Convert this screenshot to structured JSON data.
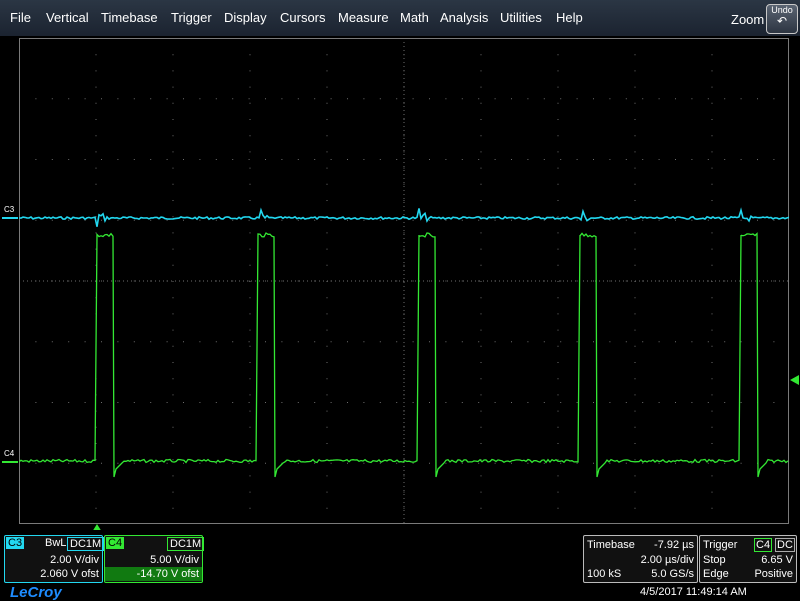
{
  "menu": [
    "File",
    "Vertical",
    "Timebase",
    "Trigger",
    "Display",
    "Cursors",
    "Measure",
    "Math",
    "Analysis",
    "Utilities",
    "Help"
  ],
  "zoom_label": "Zoom",
  "undo_label": "Undo",
  "traces": {
    "c3": {
      "label": "C3",
      "color": "#22d8f0"
    },
    "c4": {
      "label": "C4",
      "color": "#33e833"
    }
  },
  "c3_box": {
    "name": "C3",
    "bwl": "BwL",
    "coupling": "DC1M",
    "vdiv": "2.00 V/div",
    "offset": "2.060 V ofst"
  },
  "c4_box": {
    "name": "C4",
    "coupling": "DC1M",
    "vdiv": "5.00 V/div",
    "offset": "-14.70 V ofst"
  },
  "timebase": {
    "label": "Timebase",
    "delay": "-7.92 µs",
    "tdiv": "2.00 µs/div",
    "samples": "100 kS",
    "rate": "5.0 GS/s"
  },
  "trigger": {
    "label": "Trigger",
    "source": "C4",
    "coupling": "DC",
    "mode": "Stop",
    "level": "6.65 V",
    "type": "Edge",
    "slope": "Positive"
  },
  "brand": "LeCroy",
  "timestamp": "4/5/2017 11:49:14 AM"
}
